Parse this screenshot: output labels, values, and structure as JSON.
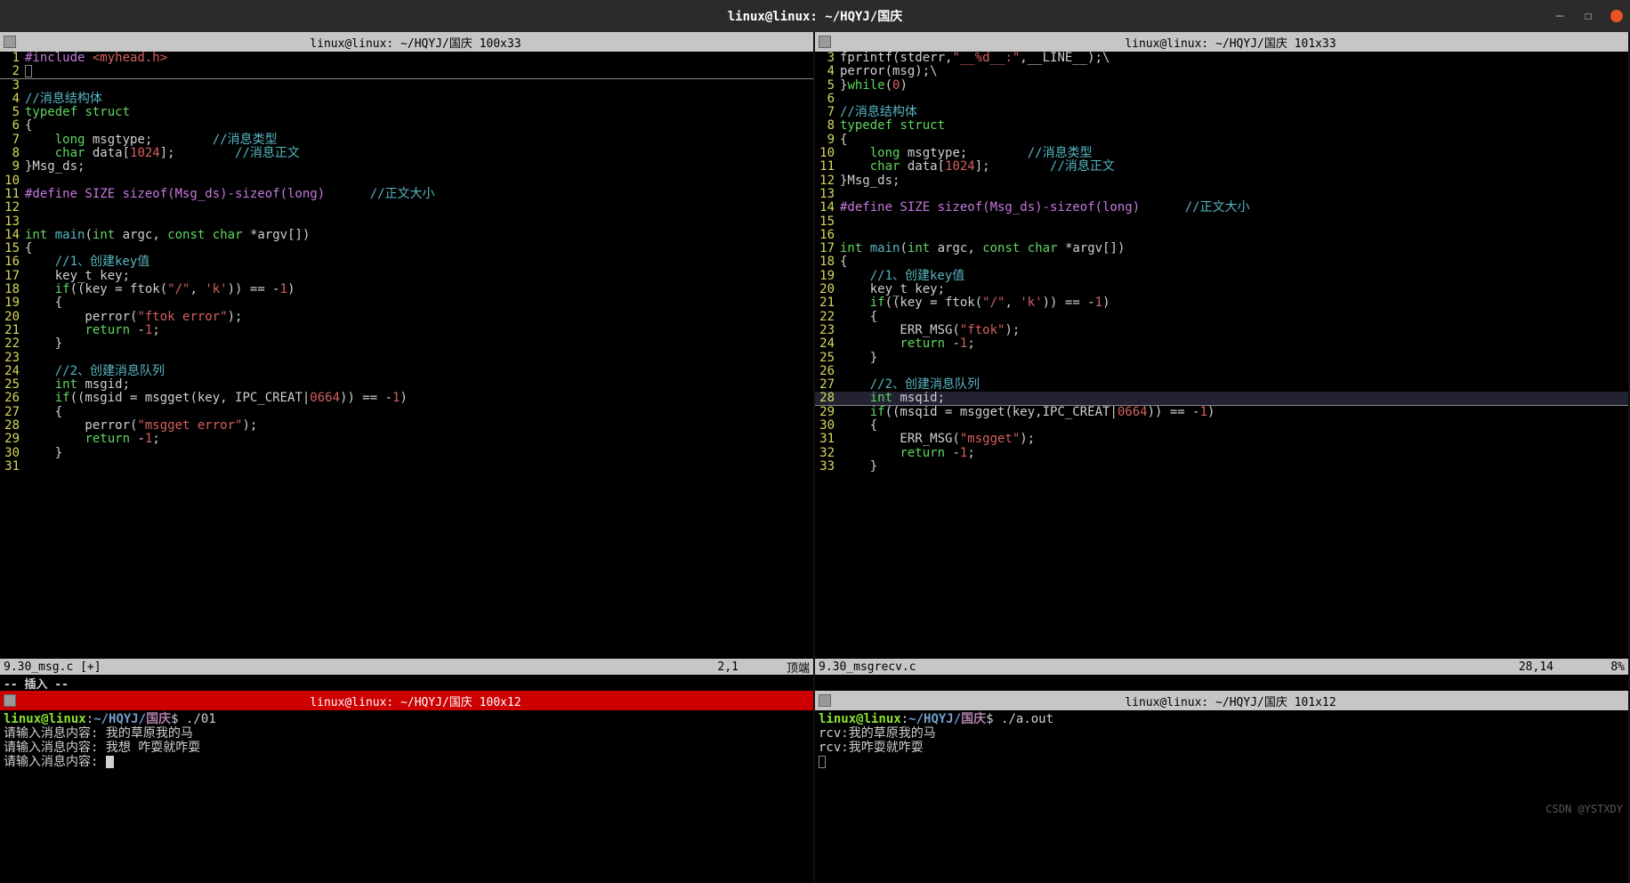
{
  "window": {
    "title": "linux@linux: ~/HQYJ/国庆"
  },
  "panes": {
    "tl_header": "linux@linux: ~/HQYJ/国庆 100x33",
    "tr_header": "linux@linux: ~/HQYJ/国庆 101x33",
    "bl_header": "linux@linux: ~/HQYJ/国庆 100x12",
    "br_header": "linux@linux: ~/HQYJ/国庆 101x12"
  },
  "left_code": {
    "start": 1,
    "lines": [
      [
        [
          "pre",
          "#include "
        ],
        [
          "inc",
          "<myhead.h>"
        ]
      ],
      [
        [
          "cursorbox",
          ""
        ]
      ],
      [],
      [
        [
          "cmt",
          "//消息结构体"
        ]
      ],
      [
        [
          "kw",
          "typedef"
        ],
        [
          "id",
          " "
        ],
        [
          "kw",
          "struct"
        ]
      ],
      [
        [
          "id",
          "{"
        ]
      ],
      [
        [
          "id",
          "    "
        ],
        [
          "typ",
          "long"
        ],
        [
          "id",
          " msgtype;        "
        ],
        [
          "cmt",
          "//消息类型"
        ]
      ],
      [
        [
          "id",
          "    "
        ],
        [
          "typ",
          "char"
        ],
        [
          "id",
          " data["
        ],
        [
          "num",
          "1024"
        ],
        [
          "id",
          "];        "
        ],
        [
          "cmt",
          "//消息正文"
        ]
      ],
      [
        [
          "id",
          "}Msg_ds;"
        ]
      ],
      [],
      [
        [
          "pre",
          "#define SIZE sizeof(Msg_ds)-sizeof(long)"
        ],
        [
          "id",
          "      "
        ],
        [
          "cmt",
          "//正文大小"
        ]
      ],
      [],
      [],
      [
        [
          "typ",
          "int"
        ],
        [
          "id",
          " "
        ],
        [
          "fn",
          "main"
        ],
        [
          "id",
          "("
        ],
        [
          "typ",
          "int"
        ],
        [
          "id",
          " argc, "
        ],
        [
          "kw",
          "const"
        ],
        [
          "id",
          " "
        ],
        [
          "typ",
          "char"
        ],
        [
          "id",
          " *argv[])"
        ]
      ],
      [
        [
          "id",
          "{"
        ]
      ],
      [
        [
          "id",
          "    "
        ],
        [
          "cmt",
          "//1、创建key值"
        ]
      ],
      [
        [
          "id",
          "    key_t key;"
        ]
      ],
      [
        [
          "id",
          "    "
        ],
        [
          "kw",
          "if"
        ],
        [
          "id",
          "((key = ftok("
        ],
        [
          "str",
          "\"/\""
        ],
        [
          "id",
          ", "
        ],
        [
          "str",
          "'k'"
        ],
        [
          "id",
          ")) == -"
        ],
        [
          "num",
          "1"
        ],
        [
          "id",
          ")"
        ]
      ],
      [
        [
          "id",
          "    {"
        ]
      ],
      [
        [
          "id",
          "        perror("
        ],
        [
          "str",
          "\"ftok error\""
        ],
        [
          "id",
          ");"
        ]
      ],
      [
        [
          "id",
          "        "
        ],
        [
          "kw",
          "return"
        ],
        [
          "id",
          " -"
        ],
        [
          "num",
          "1"
        ],
        [
          "id",
          ";"
        ]
      ],
      [
        [
          "id",
          "    }"
        ]
      ],
      [],
      [
        [
          "id",
          "    "
        ],
        [
          "cmt",
          "//2、创建消息队列"
        ]
      ],
      [
        [
          "id",
          "    "
        ],
        [
          "typ",
          "int"
        ],
        [
          "id",
          " msgid;"
        ]
      ],
      [
        [
          "id",
          "    "
        ],
        [
          "kw",
          "if"
        ],
        [
          "id",
          "((msgid = msgget(key, IPC_CREAT|"
        ],
        [
          "num",
          "0664"
        ],
        [
          "id",
          ")) == -"
        ],
        [
          "num",
          "1"
        ],
        [
          "id",
          ")"
        ]
      ],
      [
        [
          "id",
          "    {"
        ]
      ],
      [
        [
          "id",
          "        perror("
        ],
        [
          "str",
          "\"msgget error\""
        ],
        [
          "id",
          ");"
        ]
      ],
      [
        [
          "id",
          "        "
        ],
        [
          "kw",
          "return"
        ],
        [
          "id",
          " -"
        ],
        [
          "num",
          "1"
        ],
        [
          "id",
          ";"
        ]
      ],
      [
        [
          "id",
          "    }"
        ]
      ],
      []
    ],
    "status_file": "9.30_msg.c [+]",
    "status_pos": "2,1",
    "status_scroll": "顶端",
    "mode": "-- 插入 --"
  },
  "right_code": {
    "start": 3,
    "lines": [
      [
        [
          "id",
          "fprintf(stderr,"
        ],
        [
          "str",
          "\"__%d__:\""
        ],
        [
          "id",
          ",__LINE__);\\"
        ]
      ],
      [
        [
          "id",
          "perror(msg);\\"
        ]
      ],
      [
        [
          "id",
          "}"
        ],
        [
          "kw",
          "while"
        ],
        [
          "id",
          "("
        ],
        [
          "num",
          "0"
        ],
        [
          "id",
          ")"
        ]
      ],
      [],
      [
        [
          "cmt",
          "//消息结构体"
        ]
      ],
      [
        [
          "kw",
          "typedef"
        ],
        [
          "id",
          " "
        ],
        [
          "kw",
          "struct"
        ]
      ],
      [
        [
          "id",
          "{"
        ]
      ],
      [
        [
          "id",
          "    "
        ],
        [
          "typ",
          "long"
        ],
        [
          "id",
          " msgtype;        "
        ],
        [
          "cmt",
          "//消息类型"
        ]
      ],
      [
        [
          "id",
          "    "
        ],
        [
          "typ",
          "char"
        ],
        [
          "id",
          " data["
        ],
        [
          "num",
          "1024"
        ],
        [
          "id",
          "];        "
        ],
        [
          "cmt",
          "//消息正文"
        ]
      ],
      [
        [
          "id",
          "}Msg_ds;"
        ]
      ],
      [],
      [
        [
          "pre",
          "#define SIZE sizeof(Msg_ds)-sizeof(long)"
        ],
        [
          "id",
          "      "
        ],
        [
          "cmt",
          "//正文大小"
        ]
      ],
      [],
      [],
      [
        [
          "typ",
          "int"
        ],
        [
          "id",
          " "
        ],
        [
          "fn",
          "main"
        ],
        [
          "id",
          "("
        ],
        [
          "typ",
          "int"
        ],
        [
          "id",
          " argc, "
        ],
        [
          "kw",
          "const"
        ],
        [
          "id",
          " "
        ],
        [
          "typ",
          "char"
        ],
        [
          "id",
          " *argv[])"
        ]
      ],
      [
        [
          "id",
          "{"
        ]
      ],
      [
        [
          "id",
          "    "
        ],
        [
          "cmt",
          "//1、创建key值"
        ]
      ],
      [
        [
          "id",
          "    key_t key;"
        ]
      ],
      [
        [
          "id",
          "    "
        ],
        [
          "kw",
          "if"
        ],
        [
          "id",
          "((key = ftok("
        ],
        [
          "str",
          "\"/\""
        ],
        [
          "id",
          ", "
        ],
        [
          "str",
          "'k'"
        ],
        [
          "id",
          ")) == -"
        ],
        [
          "num",
          "1"
        ],
        [
          "id",
          ")"
        ]
      ],
      [
        [
          "id",
          "    {"
        ]
      ],
      [
        [
          "id",
          "        ERR_MSG("
        ],
        [
          "str",
          "\"ftok\""
        ],
        [
          "id",
          ");"
        ]
      ],
      [
        [
          "id",
          "        "
        ],
        [
          "kw",
          "return"
        ],
        [
          "id",
          " -"
        ],
        [
          "num",
          "1"
        ],
        [
          "id",
          ";"
        ]
      ],
      [
        [
          "id",
          "    }"
        ]
      ],
      [],
      [
        [
          "id",
          "    "
        ],
        [
          "cmt",
          "//2、创建消息队列"
        ]
      ],
      [
        [
          "id",
          "    "
        ],
        [
          "typ",
          "int"
        ],
        [
          "id",
          " msqid;"
        ]
      ],
      [
        [
          "id",
          "    "
        ],
        [
          "kw",
          "if"
        ],
        [
          "id",
          "((msqid = msgget(key,IPC_CREAT|"
        ],
        [
          "num",
          "0664"
        ],
        [
          "id",
          ")) == -"
        ],
        [
          "num",
          "1"
        ],
        [
          "id",
          ")"
        ]
      ],
      [
        [
          "id",
          "    {"
        ]
      ],
      [
        [
          "id",
          "        ERR_MSG("
        ],
        [
          "str",
          "\"msgget\""
        ],
        [
          "id",
          ");"
        ]
      ],
      [
        [
          "id",
          "        "
        ],
        [
          "kw",
          "return"
        ],
        [
          "id",
          " -"
        ],
        [
          "num",
          "1"
        ],
        [
          "id",
          ";"
        ]
      ],
      [
        [
          "id",
          "    }"
        ]
      ]
    ],
    "hl_index": 25,
    "status_file": "9.30_msgrecv.c",
    "status_pos": "28,14",
    "status_scroll": "8%"
  },
  "term_left": {
    "prompt_user": "linux@linux",
    "prompt_sep": ":",
    "prompt_path": "~/HQYJ/",
    "prompt_path2": "国庆",
    "prompt_dollar": "$ ",
    "cmd": "./01",
    "lines": [
      "请输入消息内容: 我的草原我的马",
      "请输入消息内容: 我想 咋耍就咋耍",
      "请输入消息内容: "
    ]
  },
  "term_right": {
    "prompt_user": "linux@linux",
    "prompt_sep": ":",
    "prompt_path": "~/HQYJ/",
    "prompt_path2": "国庆",
    "prompt_dollar": "$ ",
    "cmd": "./a.out",
    "lines": [
      "rcv:我的草原我的马",
      "rcv:我咋耍就咋耍"
    ]
  },
  "watermark": "CSDN @YSTXDY"
}
